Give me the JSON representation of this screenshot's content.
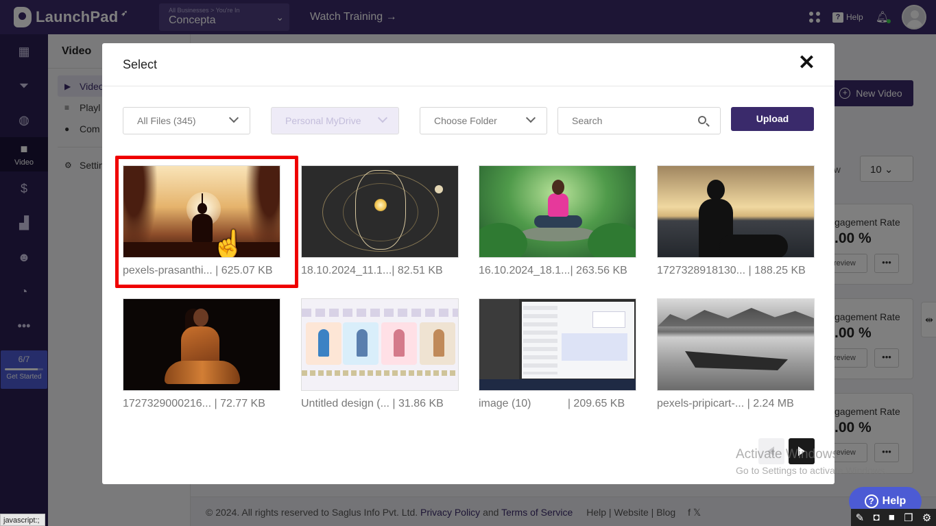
{
  "topbar": {
    "app_name": "LaunchPad",
    "business_crumb": "All Businesses > You're In",
    "business_name": "Concepta",
    "watch_training": "Watch Training →",
    "help": "Help"
  },
  "leftnav": {
    "active_label": "Video",
    "get_started": {
      "count": "6/7",
      "label": "Get Started",
      "progress": 0.86
    },
    "status_bar": "javascript:;"
  },
  "subnav": {
    "title": "Video",
    "items": [
      {
        "label": "Video",
        "icon": "play-square-icon"
      },
      {
        "label": "Playl",
        "icon": "playlist-icon"
      },
      {
        "label": "Com",
        "icon": "comments-icon"
      },
      {
        "label": "Settin",
        "icon": "gear-icon"
      }
    ]
  },
  "main": {
    "new_video": "New Video",
    "show_label": "ow",
    "show_value": "10",
    "cards": [
      {
        "label": "gagement Rate",
        "value": ".00 %",
        "preview": "review",
        "more": "•••"
      },
      {
        "label": "gagement Rate",
        "value": ".00 %",
        "preview": "review",
        "more": "•••"
      },
      {
        "label": "gagement Rate",
        "value": ".00 %",
        "preview": "review",
        "more": "•••"
      }
    ],
    "help_fab": "Help"
  },
  "footer": {
    "copyright": "©  2024. All rights reserved to Saglus Info Pvt. Ltd.",
    "privacy": "Privacy Policy",
    "and": "and",
    "terms": "Terms of Service",
    "links": [
      "Help",
      "Website",
      "Blog"
    ],
    "sep": "|"
  },
  "modal": {
    "title": "Select",
    "close": "✕",
    "filters": {
      "all_files": "All Files (345)",
      "drive": "Personal MyDrive",
      "folder": "Choose Folder",
      "search_placeholder": "Search",
      "upload": "Upload"
    },
    "files": [
      {
        "name": "pexels-prasanthi... | 625.07 KB",
        "selected": true
      },
      {
        "name": "18.10.2024_11.1...| 82.51 KB",
        "selected": false
      },
      {
        "name": "16.10.2024_18.1...| 263.56 KB",
        "selected": false
      },
      {
        "name": "1727328918130... | 188.25 KB",
        "selected": false
      },
      {
        "name": "1727329000216... | 72.77 KB",
        "selected": false
      },
      {
        "name": "Untitled design (... | 31.86 KB",
        "selected": false
      },
      {
        "name": "image (10)            | 209.65 KB",
        "selected": false
      },
      {
        "name": "pexels-pripicart-... | 2.24 MB",
        "selected": false
      }
    ]
  },
  "windows_watermark": {
    "line1": "Activate Windows",
    "line2": "Go to Settings to activate Windows."
  }
}
